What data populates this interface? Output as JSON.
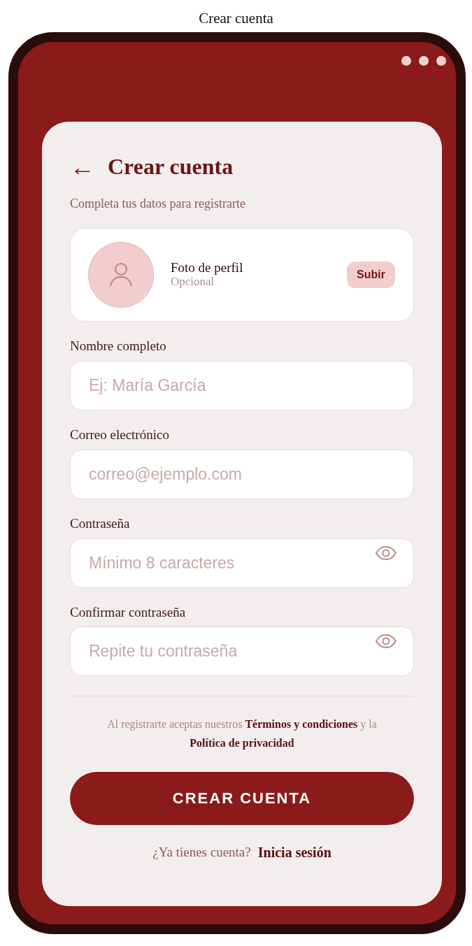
{
  "page_title": "Crear cuenta",
  "header": {
    "back": "←",
    "title": "Crear cuenta",
    "subtitle": "Completa tus datos para registrarte"
  },
  "photo": {
    "label": "Foto de perfil",
    "hint": "Opcional",
    "button": "Subir"
  },
  "fields": [
    {
      "label": "Nombre completo",
      "placeholder": "Ej: María García",
      "kind": "text"
    },
    {
      "label": "Correo electrónico",
      "placeholder": "correo@ejemplo.com",
      "kind": "email"
    },
    {
      "label": "Contraseña",
      "placeholder": "Mínimo 8 caracteres",
      "kind": "password"
    },
    {
      "label": "Confirmar contraseña",
      "placeholder": "Repite tu contraseña",
      "kind": "password"
    }
  ],
  "terms": {
    "before": "Al registrarte aceptas nuestros",
    "link_1": "Términos y condiciones",
    "middle": "y la",
    "link_2": "Política de privacidad"
  },
  "submit": "CREAR CUENTA",
  "login": {
    "question": "¿Ya tienes cuenta?",
    "link": "Inicia sesión"
  }
}
